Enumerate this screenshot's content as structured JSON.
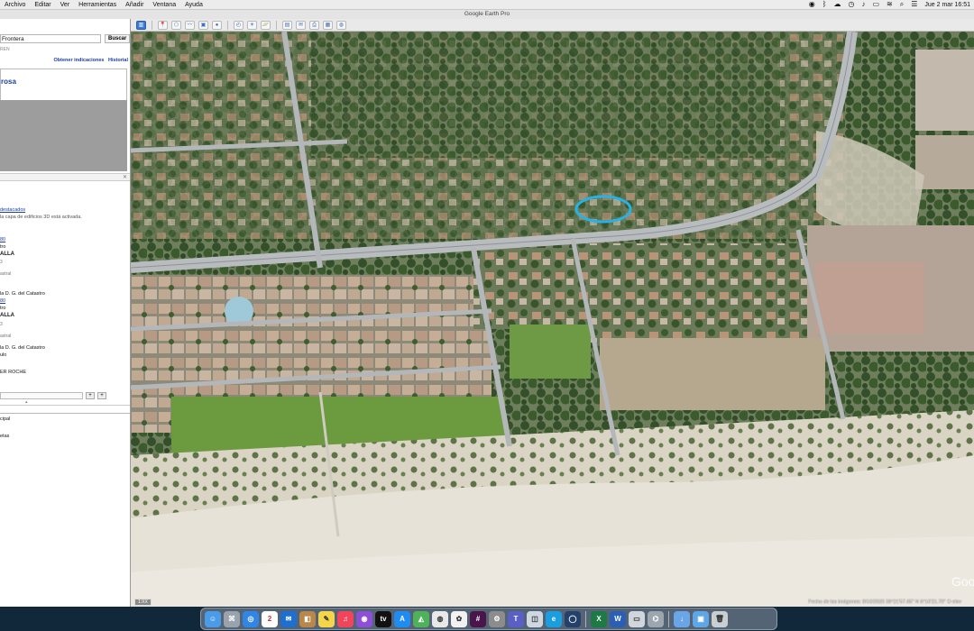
{
  "menubar": {
    "items": [
      "Archivo",
      "Editar",
      "Ver",
      "Herramientas",
      "Añadir",
      "Ventana",
      "Ayuda"
    ],
    "clock": "Jue 2 mar 16:51"
  },
  "app": {
    "title": "Google Earth Pro"
  },
  "search": {
    "value": "Frontera",
    "button_label": "Buscar",
    "sub_text": "REN"
  },
  "links": {
    "directions": "Obtener indicaciones",
    "history": "Historial"
  },
  "result": {
    "title": "rosa"
  },
  "layers": {
    "header": "destacados",
    "notice": "la capa de edificios 3D está activada.",
    "lines": [
      {
        "text": "80",
        "style": "link"
      },
      {
        "text": "tro",
        "style": ""
      },
      {
        "text": "ALLA",
        "style": "bold"
      },
      {
        "text": "3",
        "style": "small"
      },
      {
        "text": "astral",
        "style": "small"
      },
      {
        "text": "la D. G. del Catastro",
        "style": ""
      },
      {
        "text": "80",
        "style": "link"
      },
      {
        "text": "tro",
        "style": ""
      },
      {
        "text": "ALLA",
        "style": "bold"
      },
      {
        "text": "3",
        "style": "small"
      },
      {
        "text": "astral",
        "style": "small"
      },
      {
        "text": "la D. G. del Catastro",
        "style": ""
      },
      {
        "text": "ulo",
        "style": ""
      },
      {
        "text": "ER ROCHE",
        "style": ""
      }
    ]
  },
  "places": {
    "lines": [
      "cipal",
      "etas"
    ]
  },
  "map": {
    "scale_badge": "1:XX",
    "footer": "Fecha de las imágenes: 8/10/2020     36°21'57.65\" N     6°10'21.70\" O   elev",
    "logo": "Goo",
    "highlight_color": "#27b2e6"
  },
  "colors": {
    "trees": "#3b5a2e",
    "sand": "#e6e2d8",
    "road": "#b9bcbf",
    "lawn": "#6c9a3f"
  },
  "dock": {
    "icons": [
      "finder-icon",
      "launchpad-icon",
      "safari-icon",
      "calendar-icon",
      "outlook-icon",
      "contacts-icon",
      "notes-icon",
      "music-icon",
      "podcasts-icon",
      "tv-icon",
      "appstore-icon",
      "maps-icon",
      "chrome-icon",
      "photos-icon",
      "slack-icon",
      "settings-icon",
      "teams-icon",
      "preview-icon",
      "edge-icon",
      "earth-icon",
      "excel-icon",
      "word-icon",
      "screen-icon",
      "network-icon",
      "downloads-icon",
      "folder-icon",
      "trash-icon"
    ],
    "calendar_day": "2"
  }
}
